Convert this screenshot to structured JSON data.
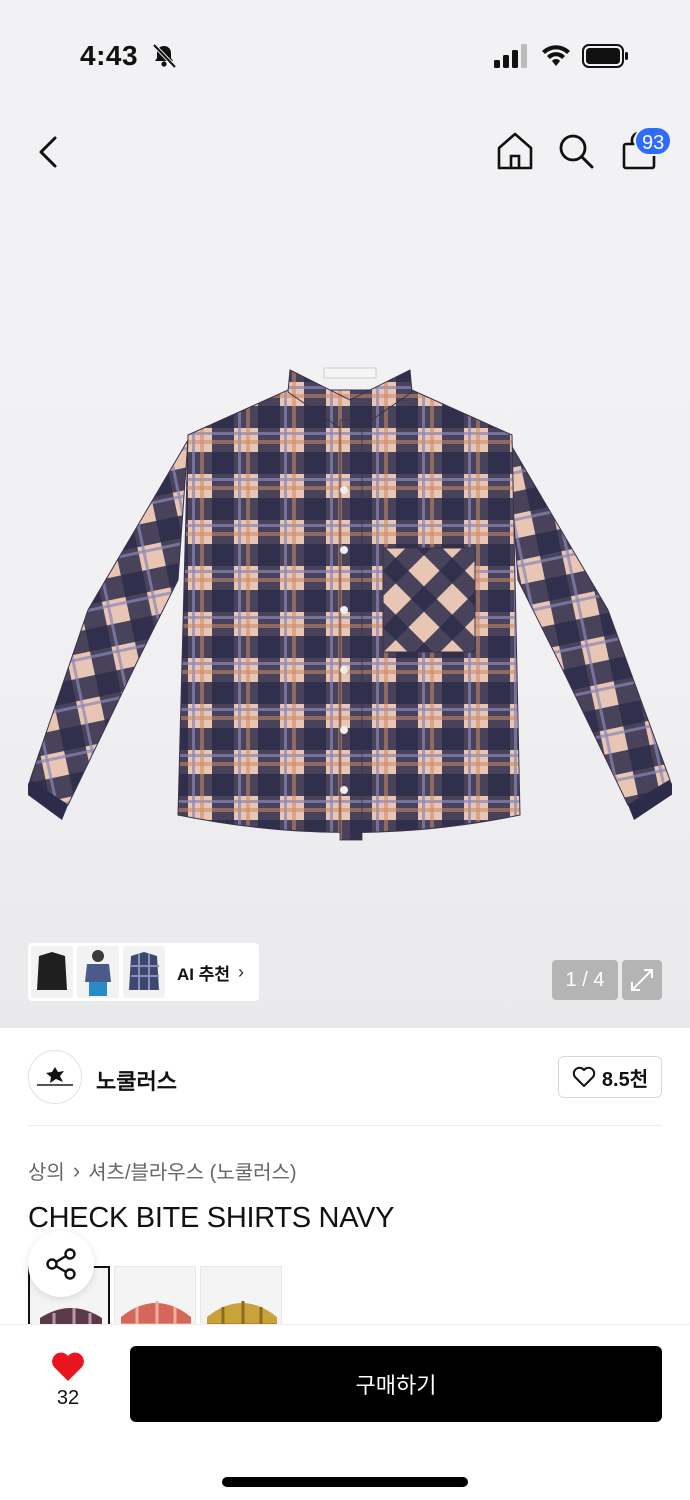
{
  "status_bar": {
    "time": "4:43"
  },
  "nav": {
    "cart_count": "93"
  },
  "gallery": {
    "ai_recommend_label": "AI 추천",
    "page_indicator": "1 / 4"
  },
  "store": {
    "name": "노쿨러스",
    "likes": "8.5천"
  },
  "product": {
    "breadcrumb": [
      "상의",
      "셔츠/블라우스 (노쿨러스)"
    ],
    "title": "CHECK BITE SHIRTS NAVY"
  },
  "bottom_bar": {
    "wish_count": "32",
    "buy_label": "구매하기"
  },
  "colors": {
    "accent_badge": "#2f6bff",
    "wish_heart": "#e8141e",
    "buy_button": "#000000"
  }
}
